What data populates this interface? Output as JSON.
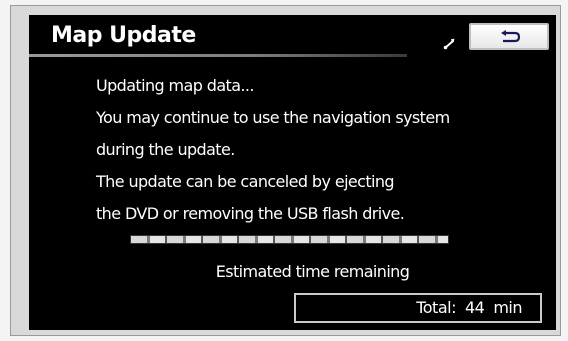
{
  "header": {
    "title": "Map Update",
    "signal_icon": "signal-icon",
    "back_icon": "return-arrow-icon"
  },
  "message": {
    "lines": [
      "Updating map data...",
      "You may continue to use the navigation system",
      "during the update.",
      "The update can be canceled by ejecting",
      "the DVD or removing the USB flash drive."
    ]
  },
  "progress": {
    "fraction": 1.0
  },
  "eta": {
    "label": "Estimated time remaining",
    "total_label": "Total:",
    "total_value": "44",
    "total_unit": "min"
  },
  "colors": {
    "screen_background": "#000000",
    "text": "#ffffff",
    "button_background": "#ffffff",
    "frame": "#d9d9d9"
  }
}
